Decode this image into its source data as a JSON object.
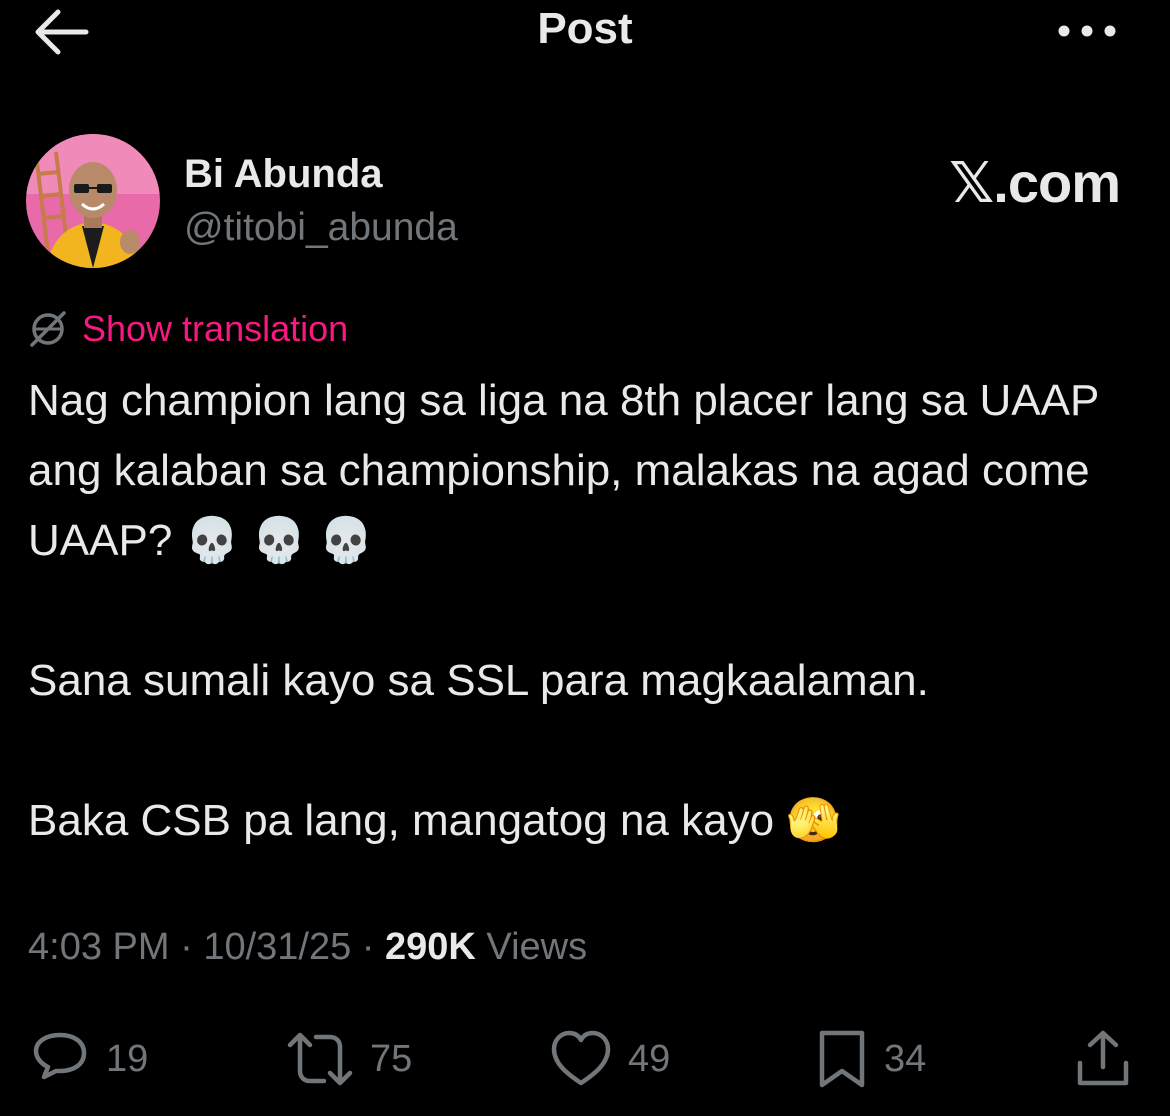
{
  "header": {
    "title": "Post",
    "back_icon": "arrow-left-icon",
    "more_icon": "more-dots-icon"
  },
  "author": {
    "display_name": "Bi Abunda",
    "handle": "@titobi_abunda",
    "avatar_colors": {
      "background": "#e86aa8",
      "jacket": "#f2b41f",
      "skin": "#b98a6a"
    }
  },
  "watermark": {
    "x_glyph": "𝕏",
    "suffix": ".com"
  },
  "translation": {
    "label": "Show translation",
    "icon": "globe-slash-icon",
    "color": "#f91880"
  },
  "post": {
    "paragraph_1": "Nag champion lang sa liga na 8th placer lang sa UAAP ang kalaban sa championship, malakas na agad come UAAP? 💀 💀 💀",
    "paragraph_2": "Sana sumali kayo sa SSL para magkaalaman.",
    "paragraph_3": "Baka CSB pa lang, mangatog na kayo 🫣"
  },
  "meta": {
    "time": "4:03 PM",
    "date": "10/31/25",
    "separator": " · ",
    "views_count": "290K",
    "views_label": "Views"
  },
  "actions": {
    "reply": {
      "icon": "reply-icon",
      "count": "19"
    },
    "repost": {
      "icon": "repost-icon",
      "count": "75"
    },
    "like": {
      "icon": "heart-icon",
      "count": "49"
    },
    "bookmark": {
      "icon": "bookmark-icon",
      "count": "34"
    },
    "share": {
      "icon": "share-icon"
    }
  },
  "colors": {
    "background": "#000000",
    "text_primary": "#e7e9ea",
    "text_secondary": "#71767b",
    "accent": "#f91880"
  }
}
